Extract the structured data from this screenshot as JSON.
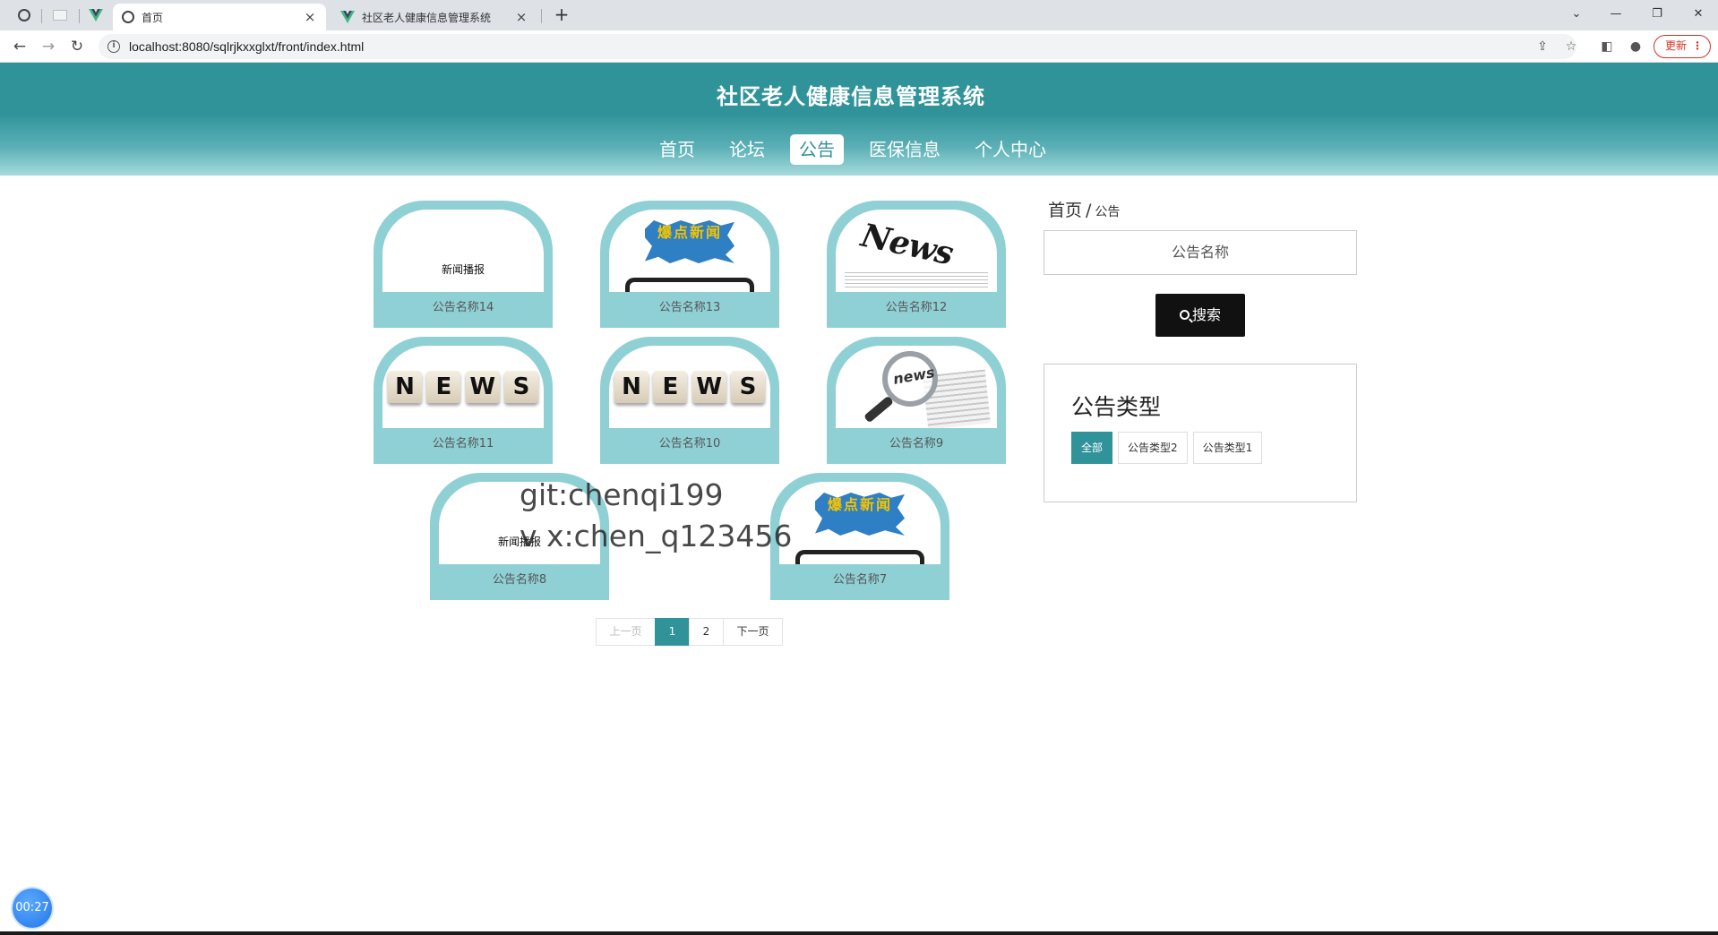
{
  "browser": {
    "tabs": [
      {
        "title": "首页",
        "active": true
      },
      {
        "title": "社区老人健康信息管理系统",
        "active": false
      }
    ],
    "url": "localhost:8080/sqlrjkxxglxt/front/index.html",
    "update_label": "更新"
  },
  "site": {
    "title": "社区老人健康信息管理系统",
    "nav": [
      "首页",
      "论坛",
      "公告",
      "医保信息",
      "个人中心"
    ],
    "active_nav": "公告"
  },
  "cards": [
    {
      "title": "公告名称14",
      "thumb_text": "新闻播报"
    },
    {
      "title": "公告名称13",
      "thumb_text": "爆点新闻"
    },
    {
      "title": "公告名称12",
      "thumb_text": "News"
    },
    {
      "title": "公告名称11",
      "thumb_text": "NEWS"
    },
    {
      "title": "公告名称10",
      "thumb_text": "NEWS"
    },
    {
      "title": "公告名称9",
      "thumb_text": "news"
    },
    {
      "title": "公告名称8",
      "thumb_text": "新闻播报"
    },
    {
      "title": "公告名称7",
      "thumb_text": "爆点新闻"
    }
  ],
  "pagination": {
    "prev": "上一页",
    "pages": [
      "1",
      "2"
    ],
    "current": "1",
    "next": "下一页"
  },
  "sidebar": {
    "breadcrumb_home": "首页",
    "breadcrumb_sep": "/",
    "breadcrumb_current": "公告",
    "search_placeholder": "公告名称",
    "search_button": "搜索",
    "types_title": "公告类型",
    "types": [
      "全部",
      "公告类型2",
      "公告类型1"
    ],
    "active_type": "全部"
  },
  "overlay": {
    "watermark_line1": "git:chenqi199",
    "watermark_line2": "v x:chen_q123456",
    "timer": "00:27"
  },
  "colors": {
    "accent": "#30939a",
    "card_bg": "#8fd0d5",
    "search_button": "#111111"
  }
}
